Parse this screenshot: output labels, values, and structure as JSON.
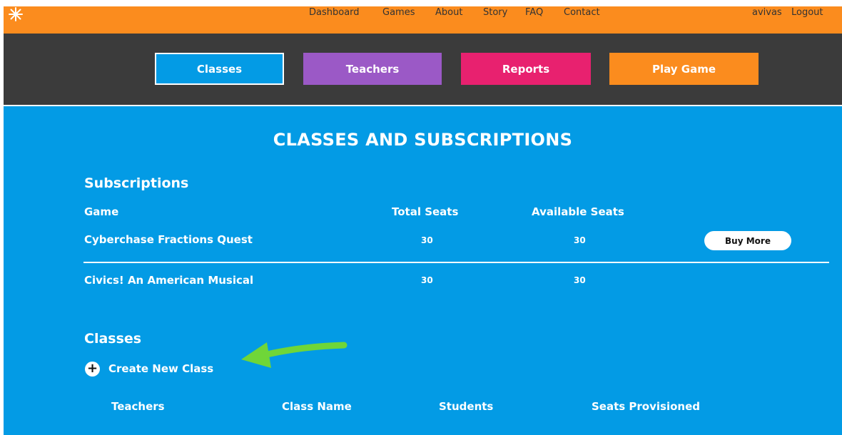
{
  "nav": {
    "links": [
      "Dashboard",
      "Games",
      "About",
      "Story",
      "FAQ",
      "Contact"
    ],
    "user": "avivas",
    "logout": "Logout"
  },
  "tabs": {
    "classes": "Classes",
    "teachers": "Teachers",
    "reports": "Reports",
    "play_game": "Play Game"
  },
  "colors": {
    "topbar": "#fb8c1e",
    "subnav": "#3b3b3b",
    "content": "#039be5",
    "tab_classes": "#039be5",
    "tab_teachers": "#9b59c6",
    "tab_reports": "#e8216f",
    "tab_play_game": "#fb8c1e",
    "annotation_arrow": "#6fd638"
  },
  "main": {
    "title": "CLASSES AND SUBSCRIPTIONS",
    "subscriptions": {
      "title": "Subscriptions",
      "headers": {
        "game": "Game",
        "total_seats": "Total Seats",
        "available_seats": "Available Seats"
      },
      "rows": [
        {
          "game": "Cyberchase Fractions Quest",
          "total_seats": "30",
          "available_seats": "30",
          "action": "Buy More"
        },
        {
          "game": "Civics! An American Musical",
          "total_seats": "30",
          "available_seats": "30"
        }
      ]
    },
    "classes": {
      "title": "Classes",
      "create_label": "Create New Class",
      "headers": {
        "teachers": "Teachers",
        "class_name": "Class Name",
        "students": "Students",
        "seats_provisioned": "Seats Provisioned"
      }
    }
  }
}
